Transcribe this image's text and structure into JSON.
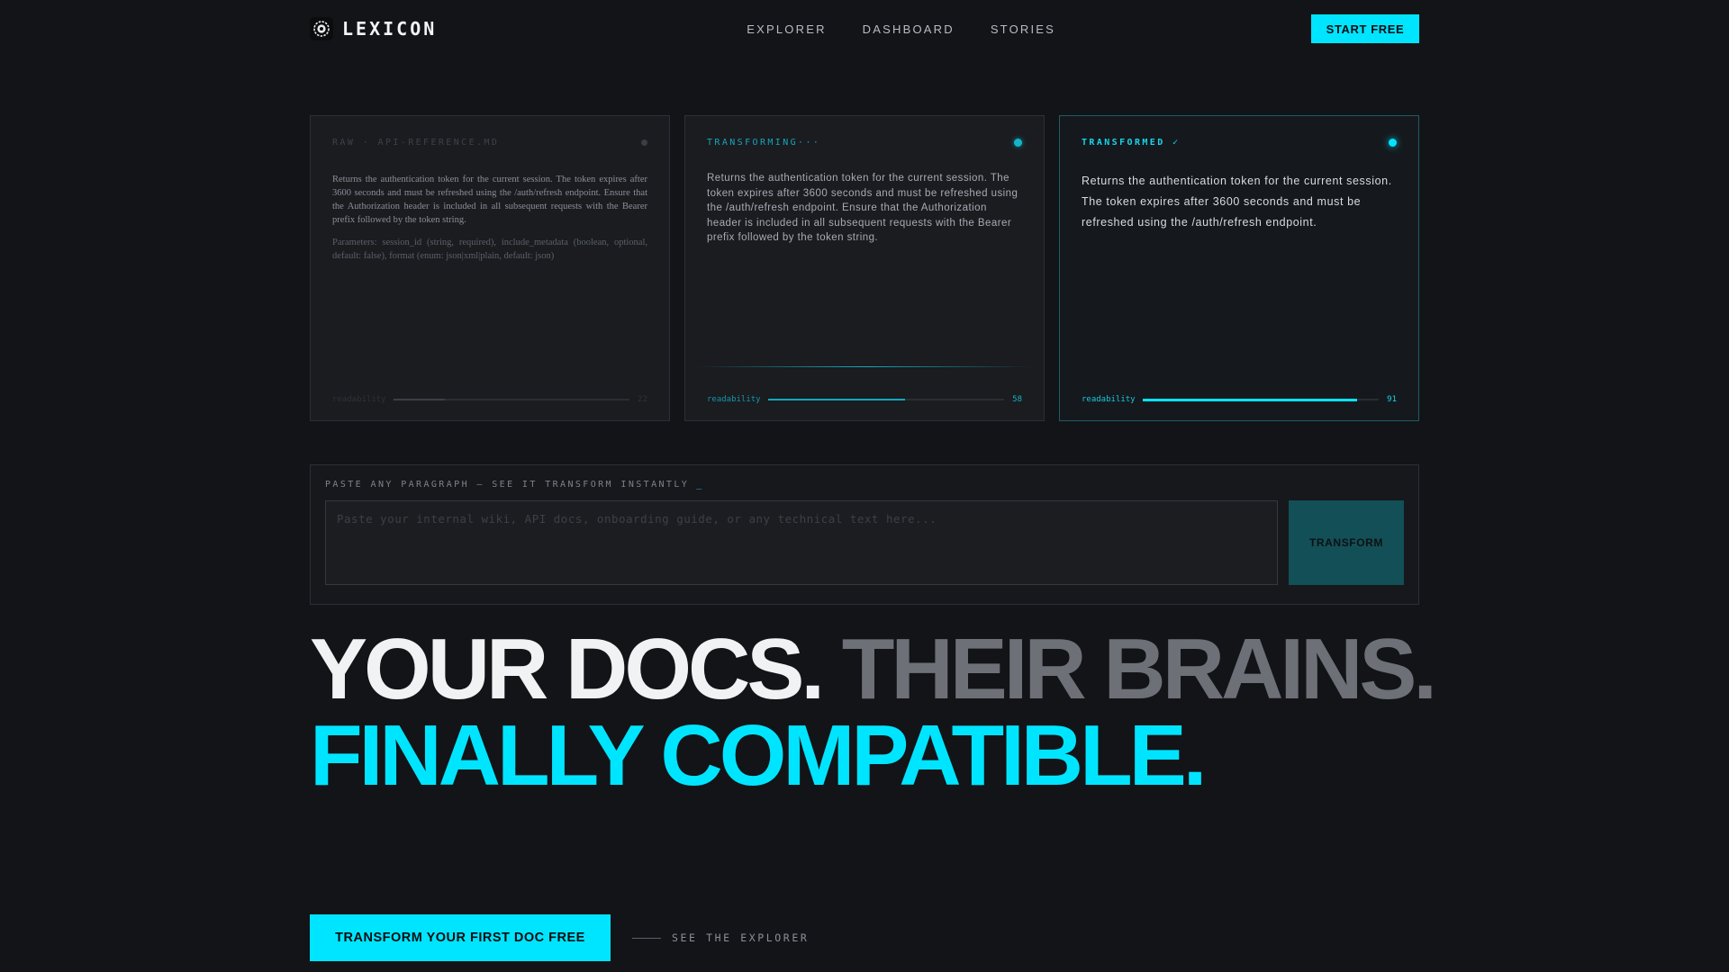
{
  "nav": {
    "brand": "LEXICON",
    "logo_icon": "gear-aperture-icon",
    "links": [
      "EXPLORER",
      "DASHBOARD",
      "STORIES"
    ],
    "cta": "START FREE"
  },
  "panels": {
    "raw": {
      "label": "RAW · API-REFERENCE.MD",
      "text": "Returns the authentication token for the current session. The token expires after 3600 seconds and must be refreshed using the /auth/refresh endpoint. Ensure that the Authorization header is included in all subsequent requests with the Bearer prefix followed by the token string.",
      "params": "Parameters: session_id (string, required), include_metadata (boolean, optional, default: false), format (enum: json|xml|plain, default: json)",
      "meter_label": "readability",
      "meter_value": "22",
      "meter_fraction": 0.22
    },
    "transforming": {
      "label": "TRANSFORMING···",
      "text": "Returns the authentication token for the current session. The token expires after 3600 seconds and must be refreshed using the /auth/refresh endpoint. Ensure that the Authorization header is included in all subsequent requests with the Bearer prefix followed by the token string.",
      "meter_label": "readability",
      "meter_value": "58",
      "meter_fraction": 0.58
    },
    "transformed": {
      "label": "TRANSFORMED ✓",
      "text": "Returns the authentication token for the current session. The token expires after 3600 seconds and must be refreshed using the /auth/refresh endpoint.",
      "meter_label": "readability",
      "meter_value": "91",
      "meter_fraction": 0.91
    }
  },
  "paste": {
    "label": "PASTE ANY PARAGRAPH — SEE IT TRANSFORM INSTANTLY",
    "caret": "_",
    "placeholder": "Paste your internal wiki, API docs, onboarding guide, or any technical text here...",
    "button": "TRANSFORM"
  },
  "hero": {
    "part1": "YOUR DOCS.",
    "part2": "THEIR BRAINS.",
    "part3": "FINALLY COMPATIBLE."
  },
  "cta": {
    "primary": "TRANSFORM YOUR FIRST DOC FREE",
    "secondary": "SEE THE EXPLORER"
  },
  "colors": {
    "accent": "#00e5ff",
    "background": "#121418",
    "panel": "#1a1c20",
    "muted_heading": "#6d7077"
  }
}
